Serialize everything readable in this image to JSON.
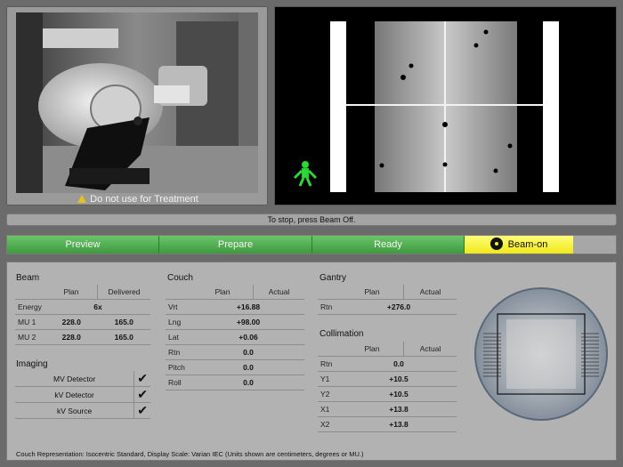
{
  "camera": {
    "warning": "Do not use for Treatment"
  },
  "status_bar": {
    "message": "To stop, press Beam Off."
  },
  "workflow": [
    {
      "label": "Preview",
      "state": "done"
    },
    {
      "label": "Prepare",
      "state": "done"
    },
    {
      "label": "Ready",
      "state": "done"
    },
    {
      "label": "Beam-on",
      "state": "active"
    }
  ],
  "beam": {
    "title": "Beam",
    "col_plan": "Plan",
    "col_delivered": "Delivered",
    "rows": [
      {
        "label": "Energy",
        "plan": "6x",
        "delivered": ""
      },
      {
        "label": "MU 1",
        "plan": "228.0",
        "delivered": "165.0"
      },
      {
        "label": "MU 2",
        "plan": "228.0",
        "delivered": "165.0"
      }
    ]
  },
  "imaging": {
    "title": "Imaging",
    "rows": [
      {
        "label": "MV Detector",
        "mark": "✔"
      },
      {
        "label": "kV Detector",
        "mark": "✔"
      },
      {
        "label": "kV Source",
        "mark": "✔"
      }
    ]
  },
  "couch": {
    "title": "Couch",
    "col_plan": "Plan",
    "col_actual": "Actual",
    "rows": [
      {
        "label": "Vrt",
        "value": "+16.88"
      },
      {
        "label": "Lng",
        "value": "+98.00"
      },
      {
        "label": "Lat",
        "value": "+0.06"
      },
      {
        "label": "Rtn",
        "value": "0.0"
      },
      {
        "label": "Pitch",
        "value": "0.0"
      },
      {
        "label": "Roll",
        "value": "0.0"
      }
    ]
  },
  "gantry": {
    "title": "Gantry",
    "col_plan": "Plan",
    "col_actual": "Actual",
    "rows": [
      {
        "label": "Rtn",
        "value": "+276.0"
      }
    ]
  },
  "collimation": {
    "title": "Collimation",
    "col_plan": "Plan",
    "col_actual": "Actual",
    "rows": [
      {
        "label": "Rtn",
        "value": "0.0"
      },
      {
        "label": "Y1",
        "value": "+10.5"
      },
      {
        "label": "Y2",
        "value": "+10.5"
      },
      {
        "label": "X1",
        "value": "+13.8"
      },
      {
        "label": "X2",
        "value": "+13.8"
      }
    ]
  },
  "footer": {
    "note": "Couch Representation: Isocentric Standard, Display Scale: Varian IEC (Units shown are centimeters, degrees or MU.)"
  }
}
